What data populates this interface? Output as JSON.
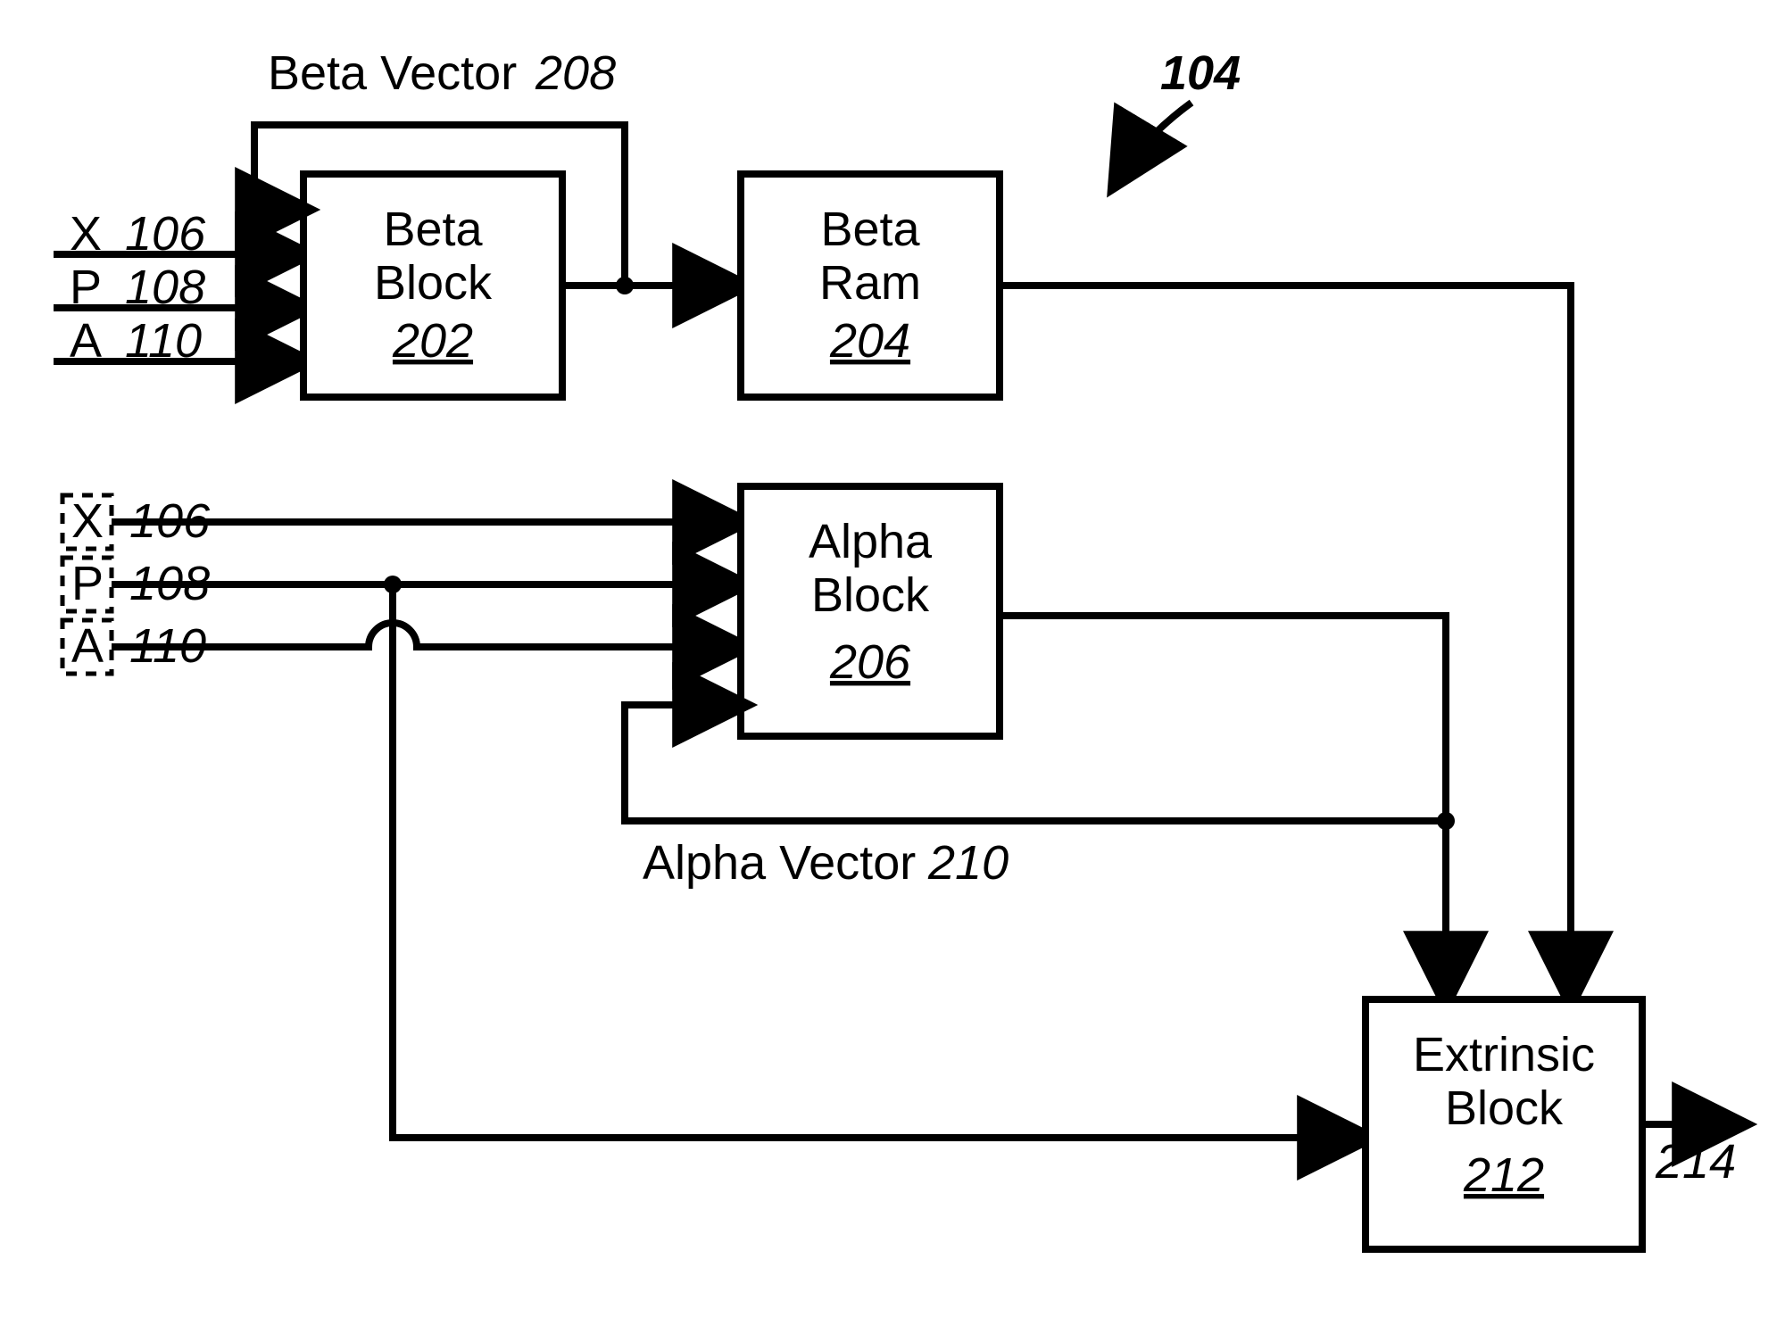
{
  "figure_ref": "104",
  "labels": {
    "beta_vector": {
      "name": "Beta Vector",
      "ref": "208"
    },
    "alpha_vector": {
      "name": "Alpha Vector",
      "ref": "210"
    },
    "output_ref": "214"
  },
  "inputs_top": [
    {
      "symbol": "X",
      "ref": "106"
    },
    {
      "symbol": "P",
      "ref": "108"
    },
    {
      "symbol": "A",
      "ref": "110"
    }
  ],
  "inputs_bottom": [
    {
      "symbol": "X",
      "ref": "106"
    },
    {
      "symbol": "P",
      "ref": "108"
    },
    {
      "symbol": "A",
      "ref": "110"
    }
  ],
  "blocks": {
    "beta_block": {
      "line1": "Beta",
      "line2": "Block",
      "ref": "202"
    },
    "beta_ram": {
      "line1": "Beta",
      "line2": "Ram",
      "ref": "204"
    },
    "alpha_block": {
      "line1": "Alpha",
      "line2": "Block",
      "ref": "206"
    },
    "extrinsic": {
      "line1": "Extrinsic",
      "line2": "Block",
      "ref": "212"
    }
  }
}
